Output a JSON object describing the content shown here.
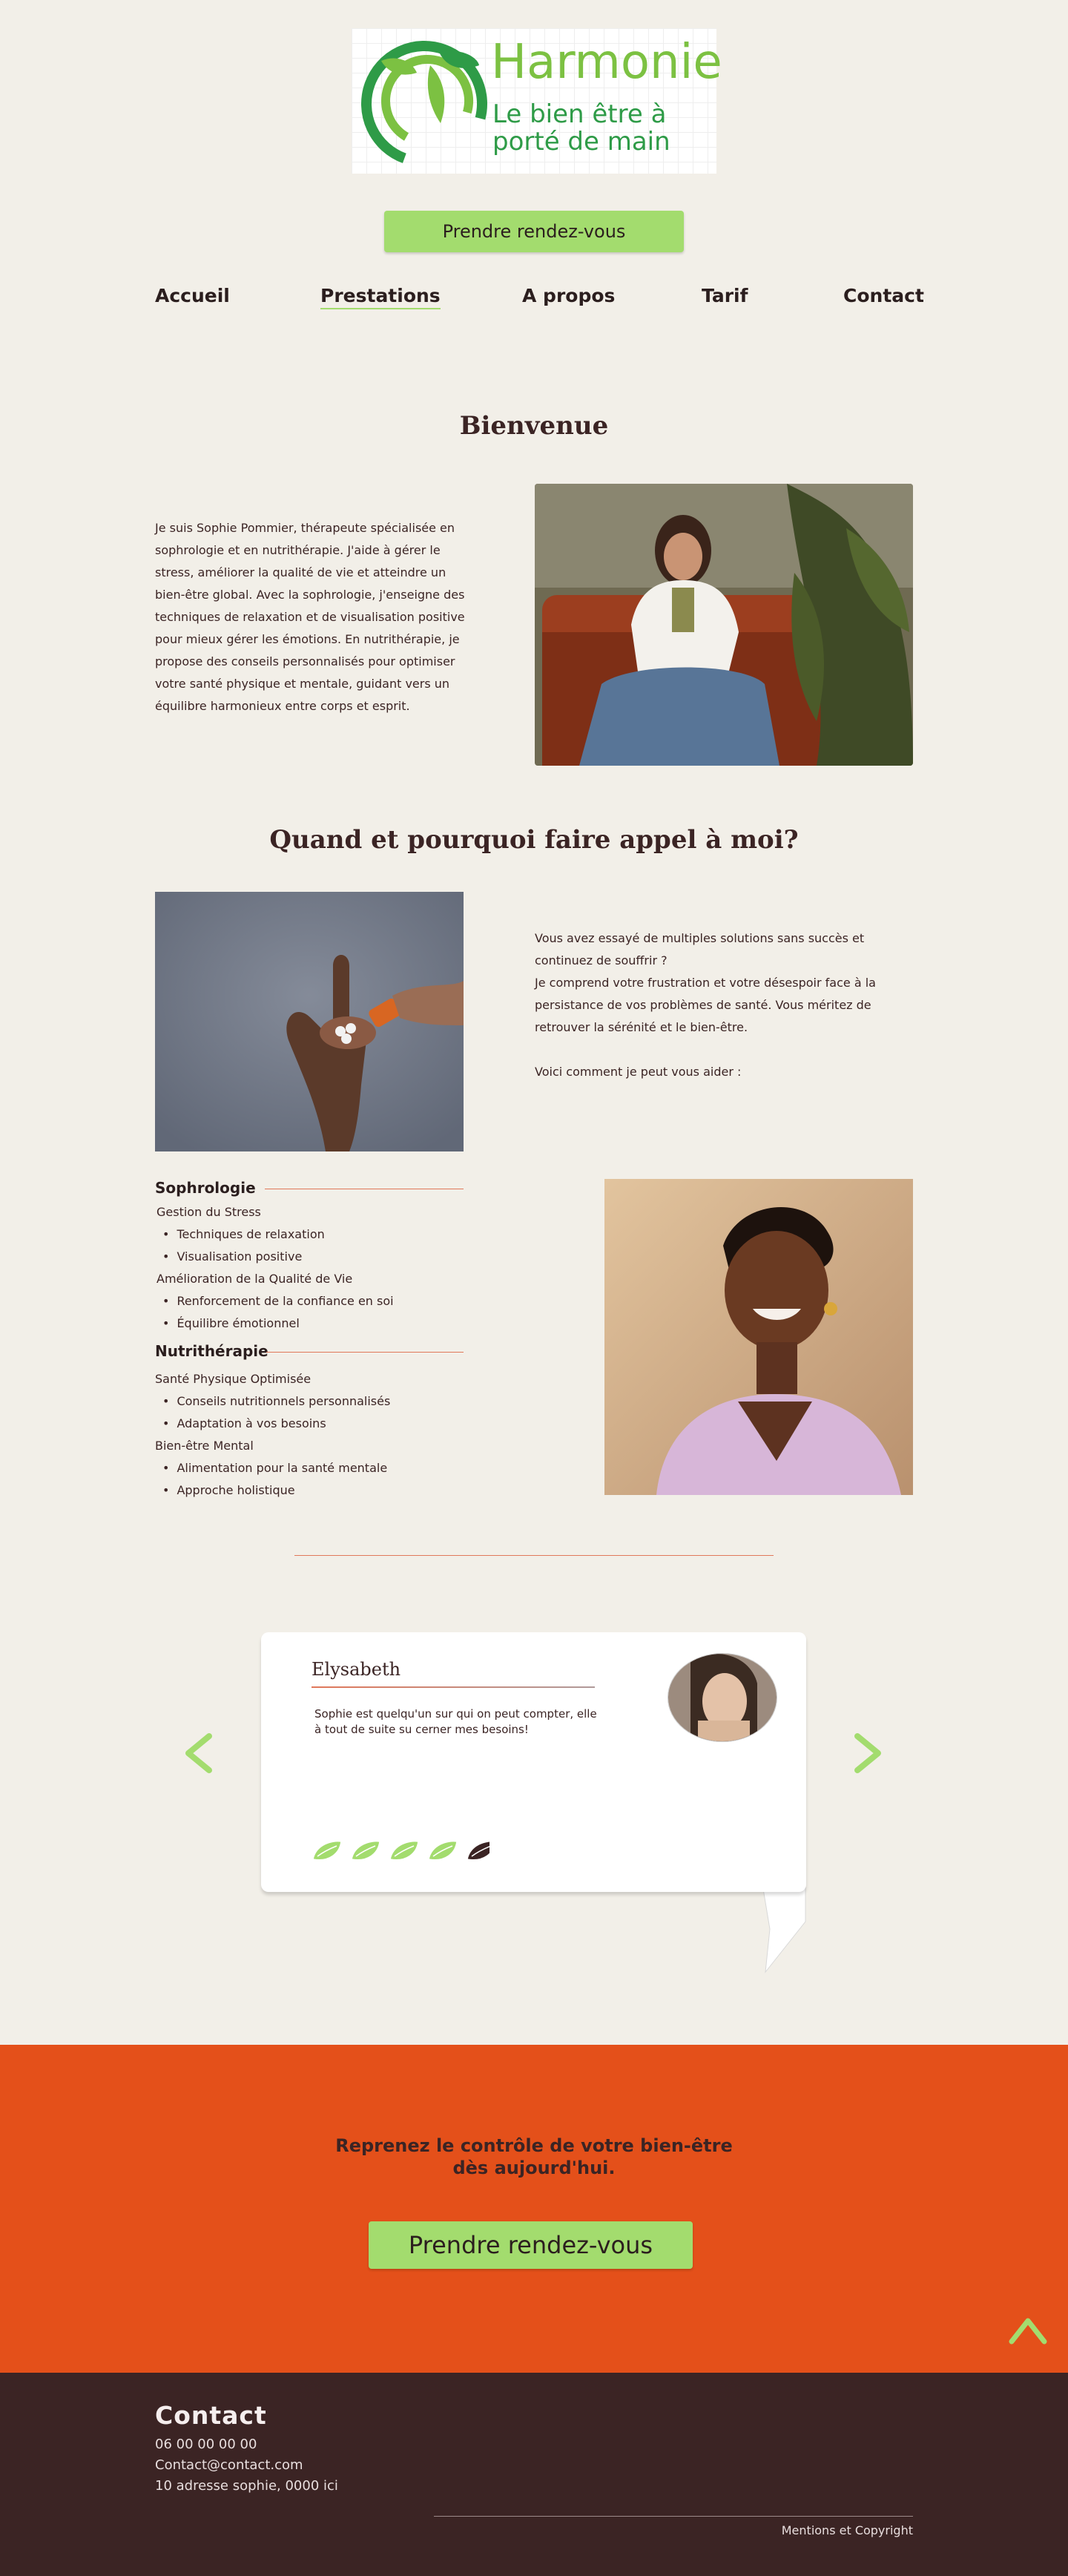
{
  "header": {
    "logo_title": "Harmonie",
    "logo_tagline_line1": "Le bien être à",
    "logo_tagline_line2": "porté de main",
    "cta_label": "Prendre rendez-vous"
  },
  "nav": {
    "items": [
      {
        "label": "Accueil"
      },
      {
        "label": "Prestations",
        "active": true
      },
      {
        "label": "A propos"
      },
      {
        "label": "Tarif"
      },
      {
        "label": "Contact"
      }
    ]
  },
  "welcome": {
    "title": "Bienvenue",
    "text": "Je suis Sophie Pommier,  thérapeute spécialisée en sophrologie et en nutrithérapie. J'aide à gérer le stress, améliorer la qualité de vie et atteindre un bien-être global. Avec la sophrologie, j'enseigne des techniques de relaxation et de visualisation positive pour mieux gérer les émotions. En nutrithérapie, je propose des conseils personnalisés pour optimiser votre santé physique et mentale, guidant vers un équilibre harmonieux entre corps et esprit."
  },
  "why": {
    "title": "Quand et pourquoi faire appel à moi?",
    "line1": "Vous avez essayé de multiples solutions sans succès et continuez de souffrir ?",
    "line2": "Je comprend votre frustration et votre désespoir face à la persistance de vos problèmes de santé. Vous méritez de retrouver la sérénité et le bien-être.",
    "line3": "Voici comment je peut vous aider :"
  },
  "services": {
    "sophro_title": "Sophrologie",
    "sophro_sub1": "Gestion du Stress",
    "sophro_sub1_items": [
      "Techniques de relaxation",
      "Visualisation positive"
    ],
    "sophro_sub2": "Amélioration de la Qualité de Vie",
    "sophro_sub2_items": [
      "Renforcement de la confiance en soi",
      "Équilibre émotionnel"
    ],
    "nutri_title": "Nutrithérapie",
    "nutri_sub1": "Santé Physique Optimisée",
    "nutri_sub1_items": [
      "Conseils nutritionnels personnalisés",
      "Adaptation à vos besoins"
    ],
    "nutri_sub2": "Bien-être Mental",
    "nutri_sub2_items": [
      "Alimentation pour la santé mentale",
      "Approche holistique"
    ]
  },
  "testimonial": {
    "name": "Elysabeth",
    "text": "Sophie est quelqu'un sur qui on peut compter, elle à tout de suite su cerner mes besoins!",
    "rating": 4,
    "rating_max": 5,
    "prev_icon": "chevron-left-icon",
    "next_icon": "chevron-right-icon"
  },
  "cta": {
    "line1": "Reprenez le contrôle de votre bien-être",
    "line2": "dès aujourd'hui.",
    "button_label": "Prendre rendez-vous"
  },
  "footer": {
    "title": "Contact",
    "phone": "06 00 00 00 00",
    "email": "Contact@contact.com",
    "address": "10 adresse sophie, 0000 ici",
    "legal": "Mentions et Copyright"
  },
  "colors": {
    "background": "#f2efe8",
    "green_accent": "#a3dc6e",
    "orange": "#e4501a",
    "dark_brown": "#3b2424",
    "line_coral": "#e0785a"
  }
}
